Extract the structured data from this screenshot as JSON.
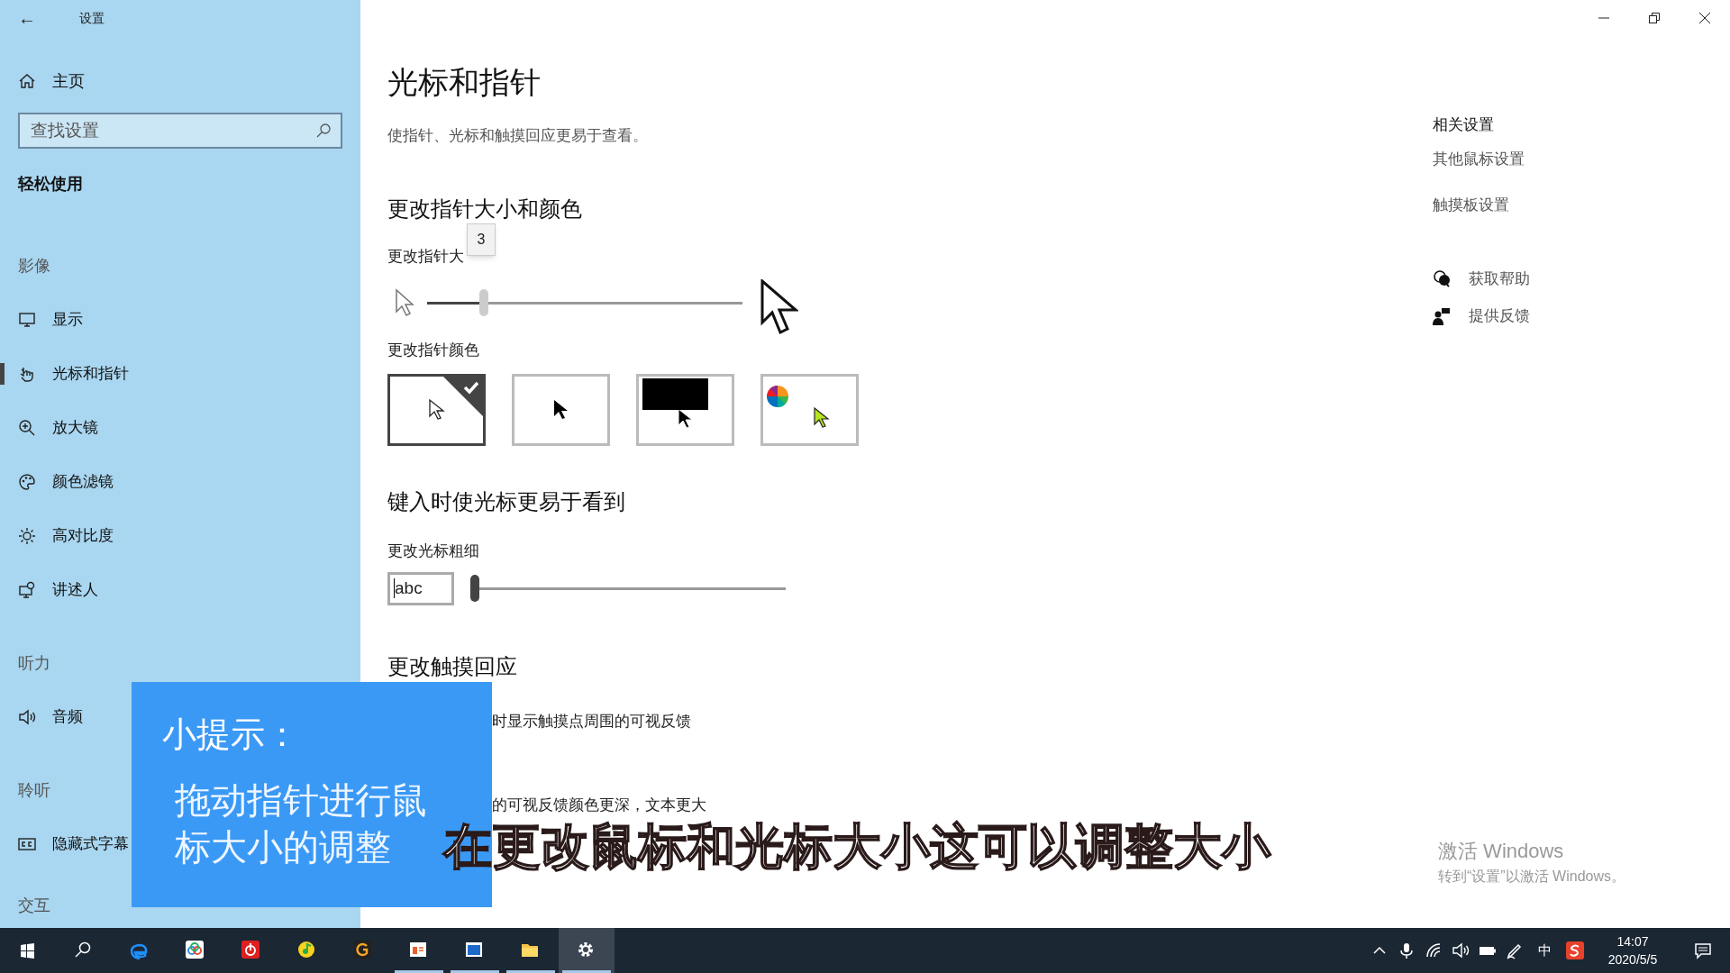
{
  "window": {
    "title": "设置",
    "back": "←"
  },
  "sidebar": {
    "home": "主页",
    "search": {
      "placeholder": "查找设置"
    },
    "category": "轻松使用",
    "groups": [
      {
        "heading": "影像",
        "items": [
          {
            "label": "显示",
            "selected": false
          },
          {
            "label": "光标和指针",
            "selected": true
          },
          {
            "label": "放大镜",
            "selected": false
          },
          {
            "label": "颜色滤镜",
            "selected": false
          },
          {
            "label": "高对比度",
            "selected": false
          },
          {
            "label": "讲述人",
            "selected": false
          }
        ]
      },
      {
        "heading": "听力",
        "items": [
          {
            "label": "音频",
            "selected": false
          }
        ]
      },
      {
        "heading": "聆听",
        "items": [
          {
            "label": "隐藏式字幕",
            "selected": false
          }
        ]
      },
      {
        "heading": "交互"
      }
    ]
  },
  "main": {
    "title": "光标和指针",
    "description": "使指针、光标和触摸回应更易于查看。",
    "size_section": {
      "heading": "更改指针大小和颜色",
      "size_label": "更改指针大",
      "size_slider": {
        "level": 0.18,
        "tooltip": "3"
      },
      "color_label": "更改指针颜色",
      "color_options": [
        {
          "kind": "white",
          "selected": true
        },
        {
          "kind": "black",
          "selected": false
        },
        {
          "kind": "inverted",
          "selected": false
        },
        {
          "kind": "custom",
          "selected": false
        }
      ]
    },
    "cursor_section": {
      "heading": "键入时使光标更易于看到",
      "label": "更改光标粗细",
      "preview": "abc",
      "thickness_slider": {
        "level": 0
      }
    },
    "touch_section": {
      "heading": "更改触摸回应",
      "lines": [
        "时显示触摸点周围的可视反馈",
        "的可视反馈颜色更深，文本更大"
      ]
    }
  },
  "related": {
    "heading": "相关设置",
    "links": [
      "其他鼠标设置",
      "触摸板设置"
    ],
    "help": [
      "获取帮助",
      "提供反馈"
    ]
  },
  "activation": {
    "title": "激活 Windows",
    "text": "转到“设置”以激活 Windows。"
  },
  "tip": {
    "title": "小提示：",
    "body": "拖动指针进行鼠标大小的调整"
  },
  "subtitle": "在更改鼠标和光标大小这可以调整大小",
  "taskbar": {
    "apps": [
      {
        "kind": "start",
        "running": false,
        "active": false
      },
      {
        "kind": "search",
        "running": false,
        "active": false
      },
      {
        "kind": "edge",
        "running": false,
        "active": false
      },
      {
        "kind": "cloud",
        "running": false,
        "active": false
      },
      {
        "kind": "music",
        "running": false,
        "active": false
      },
      {
        "kind": "qq",
        "running": false,
        "active": false
      },
      {
        "kind": "g",
        "running": false,
        "active": false
      },
      {
        "kind": "slides",
        "running": true,
        "active": false
      },
      {
        "kind": "window",
        "running": true,
        "active": false
      },
      {
        "kind": "folder",
        "running": true,
        "active": false
      },
      {
        "kind": "gear",
        "running": true,
        "active": true
      }
    ],
    "ime": "中",
    "time": "14:07",
    "date": "2020/5/5"
  }
}
